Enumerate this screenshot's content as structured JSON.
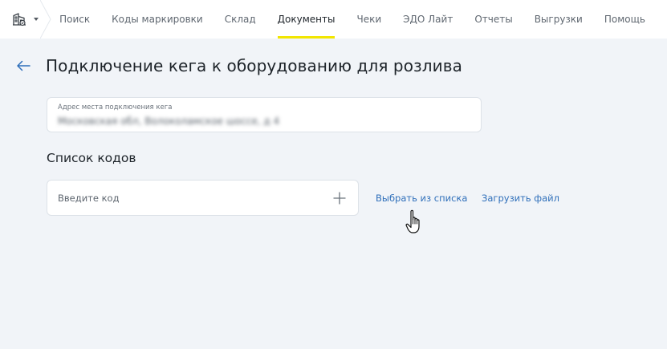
{
  "nav": {
    "items": [
      {
        "label": "Поиск",
        "active": false
      },
      {
        "label": "Коды маркировки",
        "active": false
      },
      {
        "label": "Склад",
        "active": false
      },
      {
        "label": "Документы",
        "active": true
      },
      {
        "label": "Чеки",
        "active": false
      },
      {
        "label": "ЭДО Лайт",
        "active": false
      },
      {
        "label": "Отчеты",
        "active": false
      },
      {
        "label": "Выгрузки",
        "active": false
      },
      {
        "label": "Помощь",
        "active": false
      }
    ],
    "active_indicator_color": "#f2e600"
  },
  "page": {
    "title": "Подключение кега к оборудованию для розлива"
  },
  "address_field": {
    "label": "Адрес места подключения кега",
    "value": "Московская обл, Волоколамское шоссе, д 4"
  },
  "codes": {
    "section_title": "Список кодов",
    "input_placeholder": "Введите код",
    "select_from_list_label": "Выбрать из списка",
    "upload_file_label": "Загрузить файл"
  },
  "colors": {
    "background": "#f1f4f8",
    "link": "#2f6fba",
    "title": "#1d2329"
  },
  "icons": {
    "app": "building-icon",
    "back": "arrow-left-icon",
    "add": "plus-icon",
    "pointer": "hand-cursor-icon"
  }
}
